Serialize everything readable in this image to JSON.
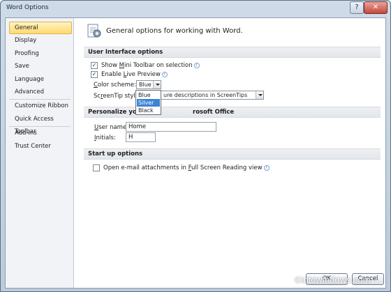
{
  "window": {
    "title": "Word Options",
    "help_glyph": "?",
    "close_glyph": "✕"
  },
  "sidebar": {
    "items": [
      {
        "label": "General",
        "active": true
      },
      {
        "label": "Display"
      },
      {
        "label": "Proofing"
      },
      {
        "label": "Save"
      },
      {
        "label": "Language"
      },
      {
        "label": "Advanced"
      },
      {
        "label": "Customize Ribbon"
      },
      {
        "label": "Quick Access Toolbar"
      },
      {
        "label": "Add-Ins"
      },
      {
        "label": "Trust Center"
      }
    ]
  },
  "main": {
    "header": "General options for working with Word.",
    "sections": {
      "ui_options": "User Interface options",
      "personalize": "Personalize your copy of Microsoft Office",
      "personalize_visible": "Personalize your co",
      "personalize_tail": "rosoft Office",
      "startup": "Start up options"
    },
    "options": {
      "mini_toolbar": {
        "pre": "Show ",
        "key": "M",
        "post": "ini Toolbar on selection",
        "checked": true
      },
      "live_preview": {
        "pre": "Enable ",
        "key": "L",
        "post": "ive Preview",
        "checked": true
      },
      "color_scheme_label": {
        "pre": "",
        "key": "C",
        "post": "olor scheme:"
      },
      "color_scheme_value": "Blue",
      "color_scheme_options": [
        "Blue",
        "Silver",
        "Black"
      ],
      "color_scheme_highlighted": "Silver",
      "screentip_label": {
        "pre": "Sc",
        "key": "r",
        "post": "eenTip style:"
      },
      "screentip_value_visible": "ure descriptions in ScreenTips",
      "user_name_label": {
        "pre": "",
        "key": "U",
        "post": "ser name:"
      },
      "user_name_value": "Home",
      "initials_label": {
        "pre": "",
        "key": "I",
        "post": "nitials:"
      },
      "initials_value": "H",
      "email_attachments": {
        "pre": "Open e-mail attachments in ",
        "key": "F",
        "post": "ull Screen Reading view",
        "checked": false
      }
    }
  },
  "footer": {
    "ok": "OK",
    "cancel": "Cancel"
  },
  "watermark": "©intowindows.com",
  "colors": {
    "active_nav": "#ffd96e",
    "dropdown_highlight": "#3c84d4",
    "info_icon": "#3b72b9"
  }
}
